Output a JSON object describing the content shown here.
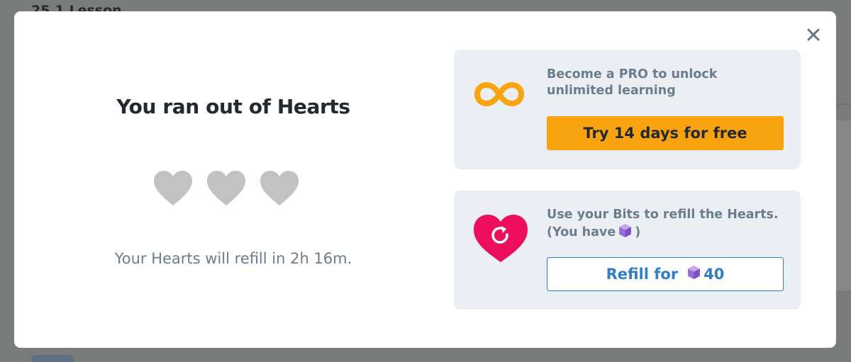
{
  "background": {
    "title": "25.1 Lesson"
  },
  "modal": {
    "title": "You ran out of Hearts",
    "hearts_total": 3,
    "hearts_remaining": 0,
    "refill_text": "Your Hearts will refill in 2h 16m.",
    "close_icon": "close-icon"
  },
  "pro_card": {
    "icon": "infinity-icon",
    "text": "Become a PRO to unlock unlimited learning",
    "button_label": "Try 14 days for free"
  },
  "bits_card": {
    "icon": "refill-heart-icon",
    "text_line1": "Use your Bits to refill the Hearts.",
    "text_line2_prefix": "(You have",
    "text_line2_suffix": ")",
    "bits_icon": "bits-cube-icon",
    "button_prefix": "Refill for",
    "button_amount": "40"
  },
  "colors": {
    "accent_orange": "#f8a30f",
    "accent_blue": "#2f7fc6",
    "heart_pink": "#ee0f5c",
    "heart_gray": "#c2c2c2",
    "bits_purple": "#9a6ad8"
  }
}
